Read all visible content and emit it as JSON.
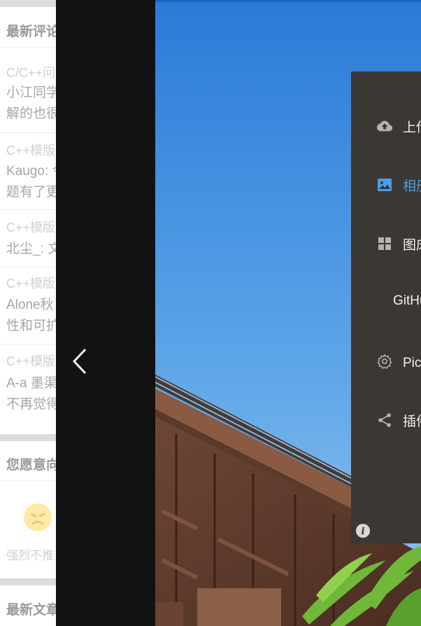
{
  "background_page": {
    "latest_comments_title": "最新评论",
    "comments": [
      {
        "title": "C/C++问",
        "lines": [
          "小江同学",
          "解的也很"
        ]
      },
      {
        "title": "C++模版",
        "lines": [
          "Kaugo: 今",
          "题有了更"
        ]
      },
      {
        "title": "C++模版",
        "lines": [
          "北尘_: 文"
        ]
      },
      {
        "title": "C++模版",
        "lines": [
          "Alone秋",
          "性和可扩"
        ]
      },
      {
        "title": "C++模版",
        "lines": [
          "A-a 墨渠",
          "不再觉得"
        ]
      }
    ],
    "survey_title": "您愿意向",
    "survey_option": "强烈不推",
    "latest_articles_title": "最新文章"
  },
  "viewer": {
    "prev_icon": "chevron-left-icon"
  },
  "menu": {
    "items": [
      {
        "label": "上传区",
        "icon": "cloud-upload-icon",
        "active": false
      },
      {
        "label": "相册",
        "icon": "image-icon",
        "active": true
      },
      {
        "label": "图床设置",
        "icon": "grid-icon",
        "active": false
      },
      {
        "label": "GitHub",
        "icon": "",
        "active": false
      },
      {
        "label": "PicGo设置",
        "icon": "gear-icon",
        "active": false
      },
      {
        "label": "插件设置",
        "icon": "share-icon",
        "active": false
      }
    ],
    "info_icon": "info-icon",
    "accent_color": "#4a9fe6",
    "panel_color": "#3b3733"
  }
}
